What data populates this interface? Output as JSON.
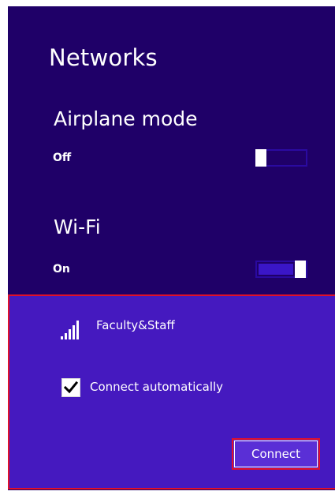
{
  "panel": {
    "title": "Networks"
  },
  "airplane_mode": {
    "label": "Airplane mode",
    "state": "Off",
    "enabled": false
  },
  "wifi": {
    "label": "Wi-Fi",
    "state": "On",
    "enabled": true
  },
  "network": {
    "name": "Faculty&Staff",
    "signal_icon": "wifi-signal-bars-icon",
    "connect_automatically_label": "Connect automatically",
    "connect_automatically_checked": true,
    "connect_button_label": "Connect"
  },
  "colors": {
    "panel_bg": "#1f0068",
    "selected_bg": "#4519bf",
    "highlight_border": "#e0102a",
    "toggle_fill": "#3a16c7"
  }
}
